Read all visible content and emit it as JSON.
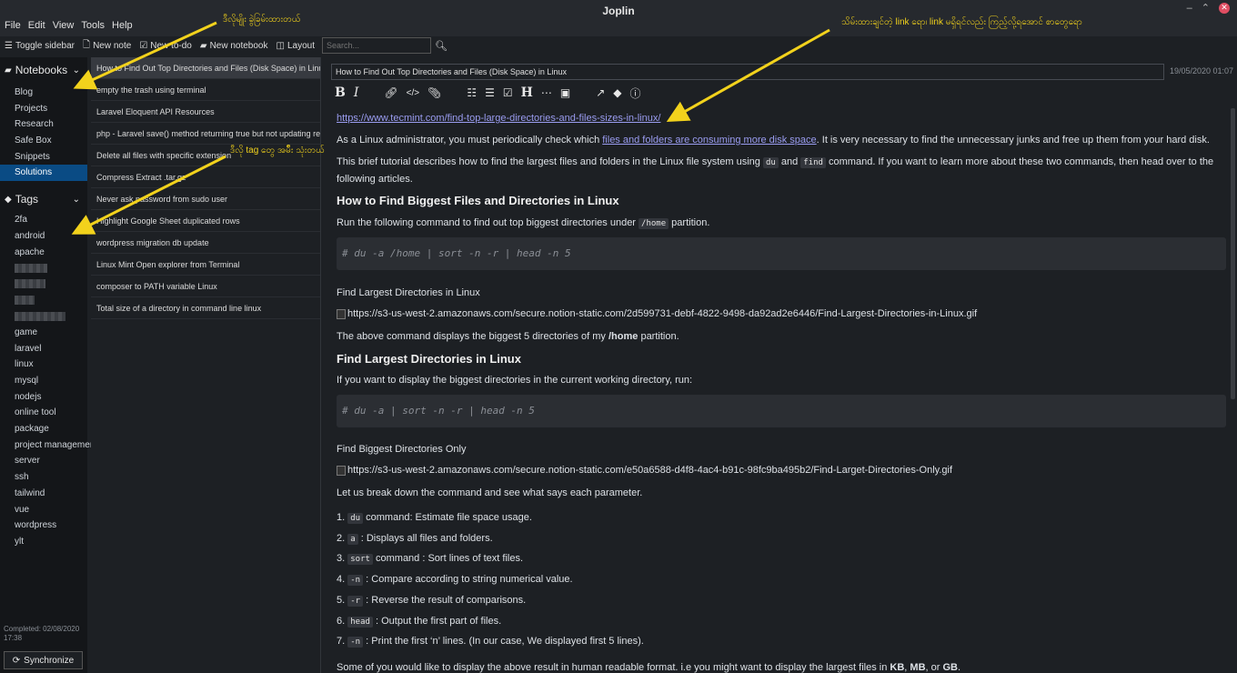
{
  "window": {
    "title": "Joplin"
  },
  "menu": [
    "File",
    "Edit",
    "View",
    "Tools",
    "Help"
  ],
  "toolbar": {
    "toggle_sidebar": "Toggle sidebar",
    "new_note": "New note",
    "new_todo": "New to-do",
    "new_notebook": "New notebook",
    "layout": "Layout",
    "search_placeholder": "Search..."
  },
  "sidebar": {
    "notebooks_header": "Notebooks",
    "notebooks": [
      {
        "label": "Blog"
      },
      {
        "label": "Projects"
      },
      {
        "label": "Research"
      },
      {
        "label": "Safe Box"
      },
      {
        "label": "Snippets"
      },
      {
        "label": "Solutions"
      }
    ],
    "tags_header": "Tags",
    "tags_top": [
      "2fa",
      "android",
      "apache"
    ],
    "tags_bottom": [
      "game",
      "laravel",
      "linux",
      "mysql",
      "nodejs",
      "online tool",
      "package",
      "project management",
      "server",
      "ssh",
      "tailwind",
      "vue",
      "wordpress",
      "ylt"
    ],
    "completed": "Completed: 02/08/2020 17:38",
    "sync_label": "Synchronize"
  },
  "notes": [
    "How to Find Out Top Directories and Files (Disk Space) in Linux",
    "empty the trash using terminal",
    "Laravel Eloquent API Resources",
    "php - Laravel save() method returning true but not updating records",
    "Delete all files with specific extension",
    "Compress Extract .tar.gz",
    "Never ask password from sudo user",
    "Highlight Google Sheet duplicated rows",
    "wordpress migration db update",
    "Linux Mint Open explorer from Terminal",
    "composer to PATH variable Linux",
    "Total size of a directory in command line linux"
  ],
  "editor": {
    "title": "How to Find Out Top Directories and Files (Disk Space) in Linux",
    "date": "19/05/2020 01:07",
    "link": "https://www.tecmint.com/find-top-large-directories-and-files-sizes-in-linux/",
    "p1_pre": "As a Linux administrator, you must periodically check which ",
    "p1_link": "files and folders are consuming more disk space",
    "p1_post": ". It is very necessary to find the unnecessary junks and free up them from your hard disk.",
    "p2_a": "This brief tutorial describes how to find the largest files and folders in the Linux file system using ",
    "p2_code1": "du",
    "p2_b": " and ",
    "p2_code2": "find",
    "p2_c": " command. If you want to learn more about these two commands, then head over to the",
    "p2_line2": "following articles.",
    "h1": "How to Find Biggest Files and Directories in Linux",
    "p3_a": "Run the following command to find out top biggest directories under ",
    "p3_code": "/home",
    "p3_b": " partition.",
    "code1": "# du -a /home | sort -n -r | head -n 5",
    "p4": "Find Largest Directories in Linux",
    "img1": "https://s3-us-west-2.amazonaws.com/secure.notion-static.com/2d599731-debf-4822-9498-da92ad2e6446/Find-Largest-Directories-in-Linux.gif",
    "p5_a": "The above command displays the biggest 5 directories of my ",
    "p5_bold": "/home",
    "p5_b": " partition.",
    "h2": "Find Largest Directories in Linux",
    "p6": "If you want to display the biggest directories in the current working directory, run:",
    "code2": "# du -a | sort -n -r | head -n 5",
    "p7": "Find Biggest Directories Only",
    "img2": "https://s3-us-west-2.amazonaws.com/secure.notion-static.com/e50a6588-d4f8-4ac4-b91c-98fc9ba495b2/Find-Larget-Directories-Only.gif",
    "p8": "Let us break down the command and see what says each parameter.",
    "list": [
      {
        "num": "1.",
        "code": "du",
        "text": " command: Estimate file space usage."
      },
      {
        "num": "2.",
        "code": "a",
        "text": " : Displays all files and folders."
      },
      {
        "num": "3.",
        "code": "sort",
        "text": " command : Sort lines of text files."
      },
      {
        "num": "4.",
        "code": "-n",
        "text": " : Compare according to string numerical value."
      },
      {
        "num": "5.",
        "code": "-r",
        "text": " : Reverse the result of comparisons."
      },
      {
        "num": "6.",
        "code": "head",
        "text": " : Output the first part of files."
      },
      {
        "num": "7.",
        "code": "-n",
        "text": " : Print the first ‘n’ lines. (In our case, We displayed first 5 lines)."
      }
    ],
    "p9_a": "Some of you would like to display the above result in human readable format. i.e you might want to display the largest files in ",
    "p9_kb": "KB",
    "p9_sep1": ", ",
    "p9_mb": "MB",
    "p9_sep2": ", or ",
    "p9_gb": "GB",
    "p9_end": "."
  },
  "annotations": {
    "a1": "ဒီလိုမျိုး ခွဲခြမ်းထားတယ်",
    "a2": "သိမ်းထားချင်တဲ့ link ရော၊ link မရှိရင်လည်း ကြည့်လို့ရအောင် စာတွေရော",
    "a3": "ဒီလို tag တွေ အမ်ိဳး သုံးတယ်"
  }
}
